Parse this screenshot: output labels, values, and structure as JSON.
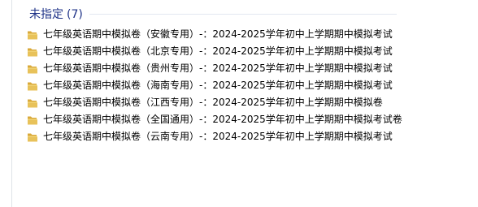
{
  "group": {
    "title": "未指定",
    "count": "(7)"
  },
  "files": [
    {
      "name": "七年级英语期中模拟卷（安徽专用）-：2024-2025学年初中上学期期中模拟考试",
      "icon": "folder-icon"
    },
    {
      "name": "七年级英语期中模拟卷（北京专用）-：2024-2025学年初中上学期期中模拟考试",
      "icon": "folder-icon"
    },
    {
      "name": "七年级英语期中模拟卷（贵州专用）-：2024-2025学年初中上学期期中模拟考试",
      "icon": "folder-icon"
    },
    {
      "name": "七年级英语期中模拟卷（海南专用）-：2024-2025学年初中上学期期中模拟考试",
      "icon": "folder-icon"
    },
    {
      "name": "七年级英语期中模拟卷（江西专用）-：2024-2025学年初中上学期期中模拟卷",
      "icon": "folder-icon"
    },
    {
      "name": "七年级英语期中模拟卷（全国通用）-：2024-2025学年初中上学期期中模拟考试卷",
      "icon": "folder-icon"
    },
    {
      "name": "七年级英语期中模拟卷（云南专用）-：2024-2025学年初中上学期期中模拟考试",
      "icon": "folder-icon"
    }
  ],
  "colors": {
    "group_title": "#1e3287",
    "folder_front": "#e8c25a",
    "folder_back": "#d9a93a"
  }
}
